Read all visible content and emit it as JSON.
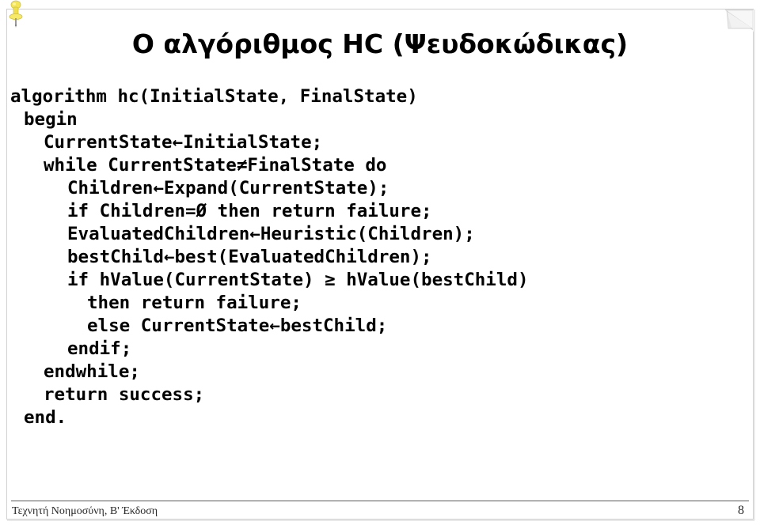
{
  "slide": {
    "title": "Ο αλγόριθμος HC (Ψευδοκώδικας)",
    "page_number": "8",
    "footer_text": "Τεχνητή Νοημοσύνη, Β' Έκδοση",
    "background_color": "#ffffff",
    "text_color": "#000000",
    "frame_color": "#d2d2d2",
    "footer_rule_color": "#5a5a5a"
  },
  "decorations": {
    "pushpin_icon": "pushpin-icon",
    "pushpin_color": "#f2e14c",
    "pagecurl_icon": "page-curl-icon",
    "pagecurl_color": "#e3e3e3"
  },
  "pseudocode": {
    "lines": [
      {
        "indent": 0,
        "text": "algorithm hc(InitialState, FinalState)"
      },
      {
        "indent": 1,
        "text": "begin"
      },
      {
        "indent": 2,
        "text": "CurrentState←InitialState;"
      },
      {
        "indent": 2,
        "text": "while CurrentState≠FinalState do"
      },
      {
        "indent": 3,
        "text": "Children←Expand(CurrentState);"
      },
      {
        "indent": 3,
        "text": "if Children=Ø then return failure;"
      },
      {
        "indent": 3,
        "text": "EvaluatedChildren←Heuristic(Children);"
      },
      {
        "indent": 3,
        "text": "bestChild←best(EvaluatedChildren);"
      },
      {
        "indent": 3,
        "text": "if hValue(CurrentState) ≥ hValue(bestChild)"
      },
      {
        "indent": 4,
        "text": "then return failure;"
      },
      {
        "indent": 4,
        "text": "else CurrentState←bestChild;"
      },
      {
        "indent": 3,
        "text": "endif;"
      },
      {
        "indent": 2,
        "text": "endwhile;"
      },
      {
        "indent": 2,
        "text": "return success;"
      },
      {
        "indent": 1,
        "text": "end."
      }
    ]
  }
}
